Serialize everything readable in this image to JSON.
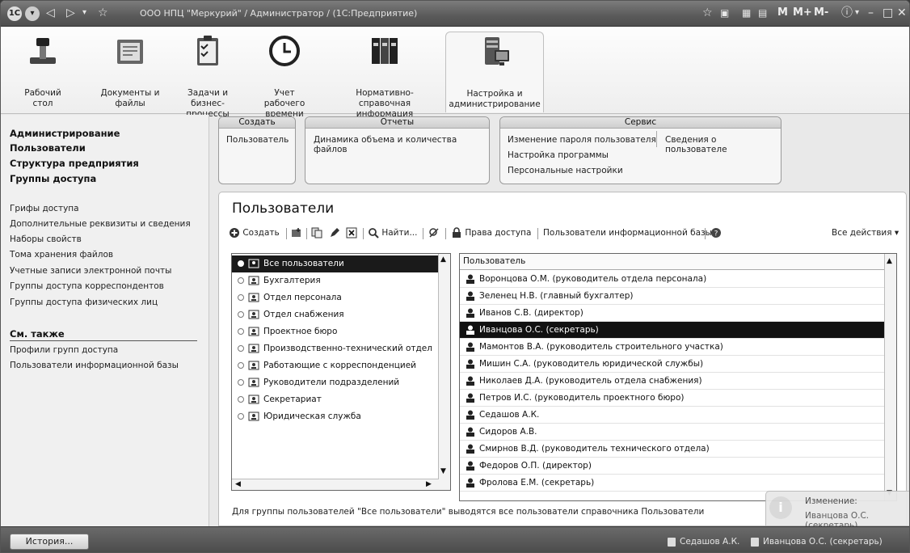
{
  "window": {
    "title": "ООО НПЦ \"Меркурий\" / Администратор / (1С:Предприятие)",
    "logo": "1С",
    "right_buttons": [
      "M",
      "M+",
      "M-"
    ]
  },
  "sections": [
    {
      "label": "Рабочий стол",
      "icon": "desktop-icon"
    },
    {
      "label": "Документы и файлы",
      "icon": "documents-icon"
    },
    {
      "label": "Задачи и бизнес-процессы",
      "icon": "tasks-icon"
    },
    {
      "label": "Учет рабочего времени",
      "icon": "clock-icon"
    },
    {
      "label": "Нормативно-справочная информация",
      "icon": "binders-icon"
    },
    {
      "label": "Настройка и администрирование",
      "icon": "server-icon"
    }
  ],
  "sidebar": {
    "bold_items": [
      "Администрирование",
      "Пользователи",
      "Структура предприятия",
      "Группы доступа"
    ],
    "links": [
      "Грифы доступа",
      "Дополнительные реквизиты и сведения",
      "Наборы свойств",
      "Тома хранения файлов",
      "Учетные записи электронной почты",
      "Группы доступа корреспондентов",
      "Группы доступа физических лиц"
    ],
    "see_also_title": "См. также",
    "see_also": [
      "Профили групп доступа",
      "Пользователи информационной базы"
    ]
  },
  "command_panel": {
    "create": {
      "title": "Создать",
      "items": [
        "Пользователь"
      ]
    },
    "reports": {
      "title": "Отчеты",
      "items": [
        "Динамика объема и количества файлов"
      ]
    },
    "service": {
      "title": "Сервис",
      "col1": [
        "Изменение пароля пользователя",
        "Настройка программы",
        "Персональные настройки"
      ],
      "col2": [
        "Сведения о пользователе"
      ]
    }
  },
  "form": {
    "title": "Пользователи",
    "toolbar": {
      "create": "Создать",
      "find": "Найти...",
      "access_rights": "Права доступа",
      "ib_users": "Пользователи информационной базы",
      "all_actions": "Все действия ▾"
    },
    "groups": [
      {
        "label": "Все пользователи",
        "selected": true
      },
      {
        "label": "Бухгалтерия",
        "selected": false
      },
      {
        "label": "Отдел персонала",
        "selected": false
      },
      {
        "label": "Отдел снабжения",
        "selected": false
      },
      {
        "label": "Проектное бюро",
        "selected": false
      },
      {
        "label": "Производственно-технический отдел",
        "selected": false
      },
      {
        "label": "Работающие с корреспонденцией",
        "selected": false
      },
      {
        "label": "Руководители подразделений",
        "selected": false
      },
      {
        "label": "Секретариат",
        "selected": false
      },
      {
        "label": "Юридическая служба",
        "selected": false
      }
    ],
    "users_header": "Пользователь",
    "users": [
      {
        "name": "Воронцова О.М. (руководитель отдела персонала)",
        "selected": false
      },
      {
        "name": "Зеленец Н.В. (главный бухгалтер)",
        "selected": false
      },
      {
        "name": "Иванов С.В. (директор)",
        "selected": false
      },
      {
        "name": "Иванцова О.С. (секретарь)",
        "selected": true
      },
      {
        "name": "Мамонтов В.А. (руководитель строительного участка)",
        "selected": false
      },
      {
        "name": "Мишин С.А. (руководитель юридической службы)",
        "selected": false
      },
      {
        "name": "Николаев Д.А. (руководитель отдела снабжения)",
        "selected": false
      },
      {
        "name": "Петров И.С. (руководитель проектного бюро)",
        "selected": false
      },
      {
        "name": "Седашов А.К.",
        "selected": false
      },
      {
        "name": "Сидоров А.В.",
        "selected": false
      },
      {
        "name": "Смирнов В.Д. (руководитель технического отдела)",
        "selected": false
      },
      {
        "name": "Федоров О.П. (директор)",
        "selected": false
      },
      {
        "name": "Фролова Е.М. (секретарь)",
        "selected": false
      }
    ],
    "note": "Для группы пользователей \"Все пользователи\" выводятся все пользователи справочника Пользователи"
  },
  "statusbar": {
    "history_button": "История...",
    "users": [
      "Седашов А.К.",
      "Иванцова О.С. (секретарь)"
    ]
  },
  "notification": {
    "title": "Изменение:",
    "text": "Иванцова О.С. (секретарь)"
  }
}
